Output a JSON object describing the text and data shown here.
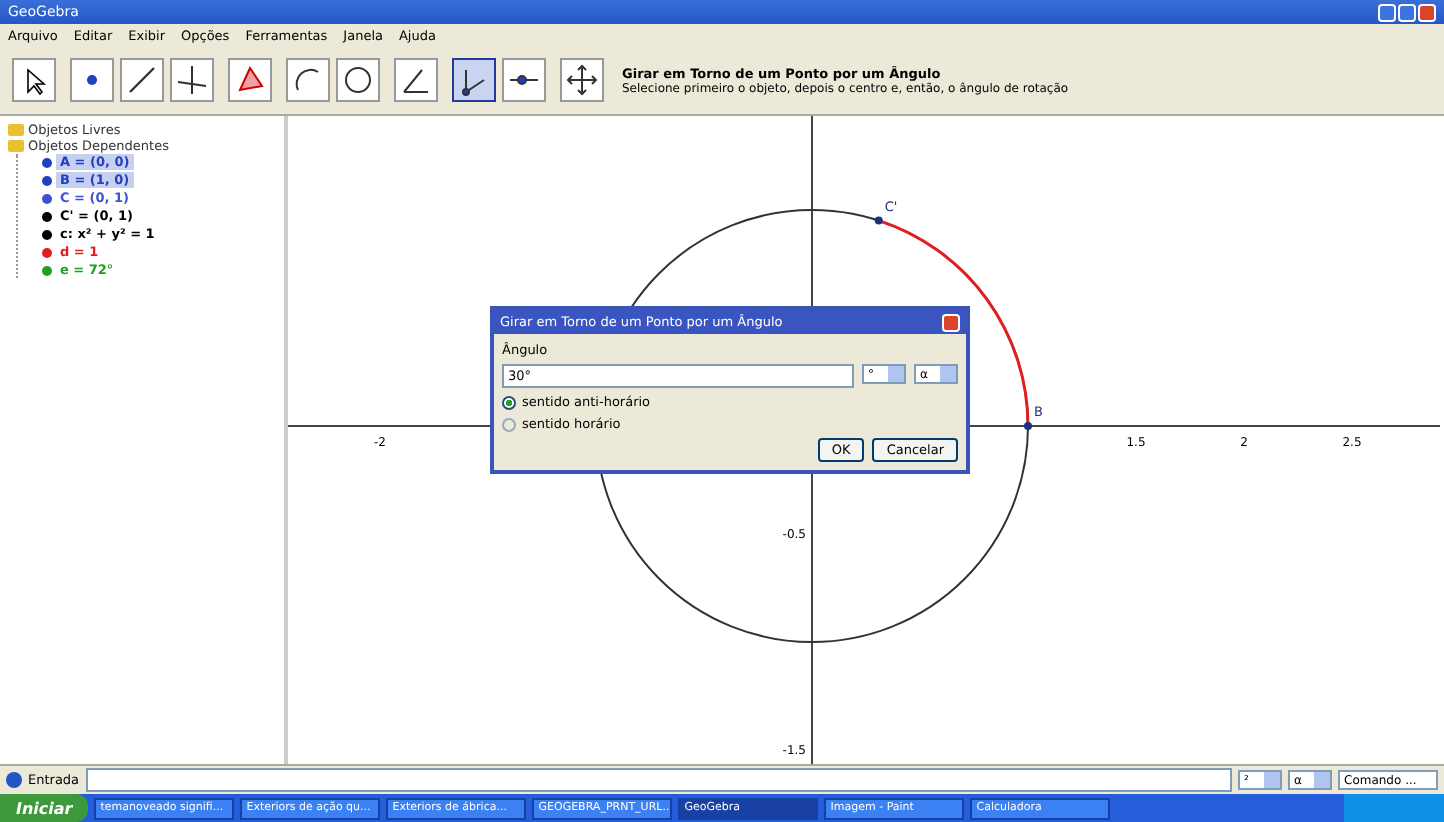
{
  "window": {
    "title": "GeoGebra"
  },
  "menu": [
    "Arquivo",
    "Editar",
    "Exibir",
    "Opções",
    "Ferramentas",
    "Janela",
    "Ajuda"
  ],
  "toolbar": {
    "tools": [
      {
        "kind": "pointer",
        "selected": false
      },
      {
        "kind": "point",
        "selected": false
      },
      {
        "kind": "line",
        "selected": false
      },
      {
        "kind": "perpendicular",
        "selected": false
      },
      {
        "kind": "polygon",
        "selected": false
      },
      {
        "kind": "arc",
        "selected": false
      },
      {
        "kind": "circle",
        "selected": false
      },
      {
        "kind": "angle",
        "selected": false
      },
      {
        "kind": "rotate",
        "selected": true
      },
      {
        "kind": "slider",
        "selected": false
      },
      {
        "kind": "move",
        "selected": false
      }
    ],
    "help_title": "Girar em Torno de um Ponto por um Ângulo",
    "help_text": "Selecione primeiro o objeto, depois o centro e, então, o ângulo de rotação"
  },
  "algebra": {
    "folders": [
      {
        "label": "Objetos Livres"
      },
      {
        "label": "Objetos Dependentes",
        "children": [
          {
            "label": "A = (0, 0)",
            "selected": true,
            "color": "#2040c0"
          },
          {
            "label": "B = (1, 0)",
            "selected": true,
            "color": "#2040c0"
          },
          {
            "label": "C = (0, 1)",
            "selected": false,
            "color": "#4050d0"
          },
          {
            "label": "C' = (0, 1)",
            "selected": false,
            "color": "#000000"
          },
          {
            "label": "c: x² + y² = 1",
            "selected": false,
            "color": "#000000"
          },
          {
            "label": "d = 1",
            "selected": false,
            "color": "#e02020"
          },
          {
            "label": "e = 72°",
            "selected": false,
            "color": "#20a020"
          }
        ]
      }
    ]
  },
  "graphics": {
    "x_labels": [
      "-2",
      "1.5",
      "2",
      "2.5"
    ],
    "y_labels": [
      "-0.5",
      "-1.5"
    ],
    "points": [
      "B",
      "C'"
    ]
  },
  "dialog": {
    "title": "Girar em Torno de um Ponto por um Ângulo",
    "field_label": "Ângulo",
    "value": "30°",
    "unit": "°",
    "symbol": "α",
    "options": [
      {
        "label": "sentido anti-horário",
        "selected": true
      },
      {
        "label": "sentido horário",
        "selected": false
      }
    ],
    "buttons": [
      "OK",
      "Cancelar"
    ]
  },
  "input_bar": {
    "label": "Entrada",
    "symbol_1": "²",
    "symbol_2": "α",
    "command": "Comando ..."
  },
  "taskbar": {
    "start": "Iniciar",
    "items": [
      {
        "label": "temanoveado signifi...",
        "selected": false
      },
      {
        "label": "Exteriors de ação qu...",
        "selected": false
      },
      {
        "label": "Exteriors de ábrica...",
        "selected": false
      },
      {
        "label": "GEOGEBRA_PRNT_URL...",
        "selected": false
      },
      {
        "label": "GeoGebra",
        "selected": true
      },
      {
        "label": "Imagem - Paint",
        "selected": false
      },
      {
        "label": "Calculadora",
        "selected": false
      }
    ]
  }
}
